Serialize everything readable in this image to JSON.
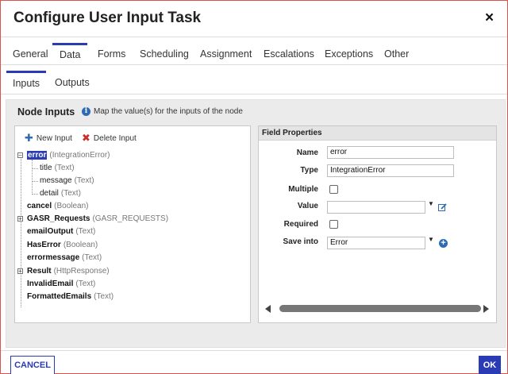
{
  "dialog": {
    "title": "Configure User Input Task",
    "close_label": "×"
  },
  "tabs": [
    {
      "label": "General",
      "active": false
    },
    {
      "label": "Data",
      "active": true
    },
    {
      "label": "Forms",
      "active": false
    },
    {
      "label": "Scheduling",
      "active": false
    },
    {
      "label": "Assignment",
      "active": false
    },
    {
      "label": "Escalations",
      "active": false
    },
    {
      "label": "Exceptions",
      "active": false
    },
    {
      "label": "Other",
      "active": false
    }
  ],
  "subtabs": [
    {
      "label": "Inputs",
      "active": true
    },
    {
      "label": "Outputs",
      "active": false
    }
  ],
  "section": {
    "title": "Node Inputs",
    "info_text": "Map the value(s) for the inputs of the node"
  },
  "tree_toolbar": {
    "new_input_label": "New Input",
    "delete_input_label": "Delete Input"
  },
  "tree": [
    {
      "name": "error",
      "type": "(IntegrationError)",
      "expanded": true,
      "selected": true
    },
    {
      "name": "title",
      "type": "(Text)",
      "child": true
    },
    {
      "name": "message",
      "type": "(Text)",
      "child": true
    },
    {
      "name": "detail",
      "type": "(Text)",
      "child": true
    },
    {
      "name": "cancel",
      "type": "(Boolean)"
    },
    {
      "name": "GASR_Requests",
      "type": "(GASR_REQUESTS)",
      "expandable": true
    },
    {
      "name": "emailOutput",
      "type": "(Text)"
    },
    {
      "name": "HasError",
      "type": "(Boolean)"
    },
    {
      "name": "errormessage",
      "type": "(Text)"
    },
    {
      "name": "Result",
      "type": "(HttpResponse)",
      "expandable": true
    },
    {
      "name": "InvalidEmail",
      "type": "(Text)"
    },
    {
      "name": "FormattedEmails",
      "type": "(Text)"
    }
  ],
  "field_properties": {
    "header": "Field Properties",
    "name_label": "Name",
    "name_value": "error",
    "type_label": "Type",
    "type_value": "IntegrationError",
    "multiple_label": "Multiple",
    "multiple_checked": false,
    "value_label": "Value",
    "value_value": "",
    "required_label": "Required",
    "required_checked": false,
    "save_into_label": "Save into",
    "save_into_value": "Error"
  },
  "footer": {
    "cancel_label": "CANCEL",
    "ok_label": "OK"
  },
  "colors": {
    "accent": "#2a3bb5",
    "delete_red": "#c9302c",
    "info_blue": "#2d6bb5",
    "dialog_border": "#d9534f"
  }
}
